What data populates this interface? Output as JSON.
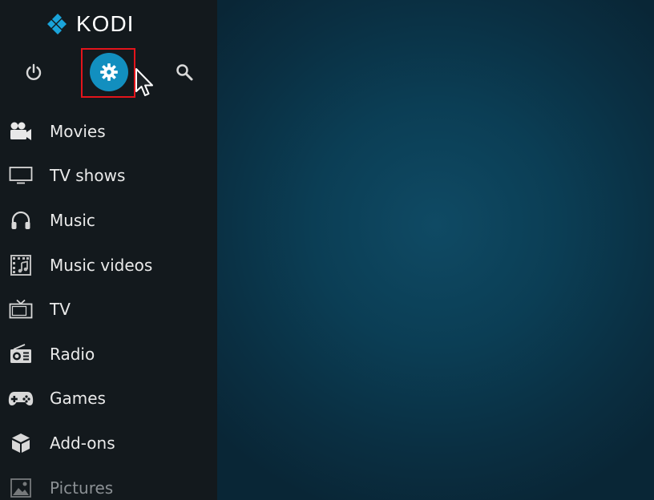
{
  "app": {
    "brand": "KODI",
    "accent_color": "#128fbf",
    "highlight_color": "#e3141b"
  },
  "toolbar": {
    "power_icon": "power-icon",
    "settings_icon": "gear-icon",
    "search_icon": "search-icon"
  },
  "menu": {
    "items": [
      {
        "label": "Movies",
        "icon": "movie-camera-icon"
      },
      {
        "label": "TV shows",
        "icon": "monitor-icon"
      },
      {
        "label": "Music",
        "icon": "headphones-icon"
      },
      {
        "label": "Music videos",
        "icon": "film-music-icon"
      },
      {
        "label": "TV",
        "icon": "tv-icon"
      },
      {
        "label": "Radio",
        "icon": "radio-icon"
      },
      {
        "label": "Games",
        "icon": "gamepad-icon"
      },
      {
        "label": "Add-ons",
        "icon": "addons-box-icon"
      },
      {
        "label": "Pictures",
        "icon": "picture-icon"
      }
    ]
  }
}
